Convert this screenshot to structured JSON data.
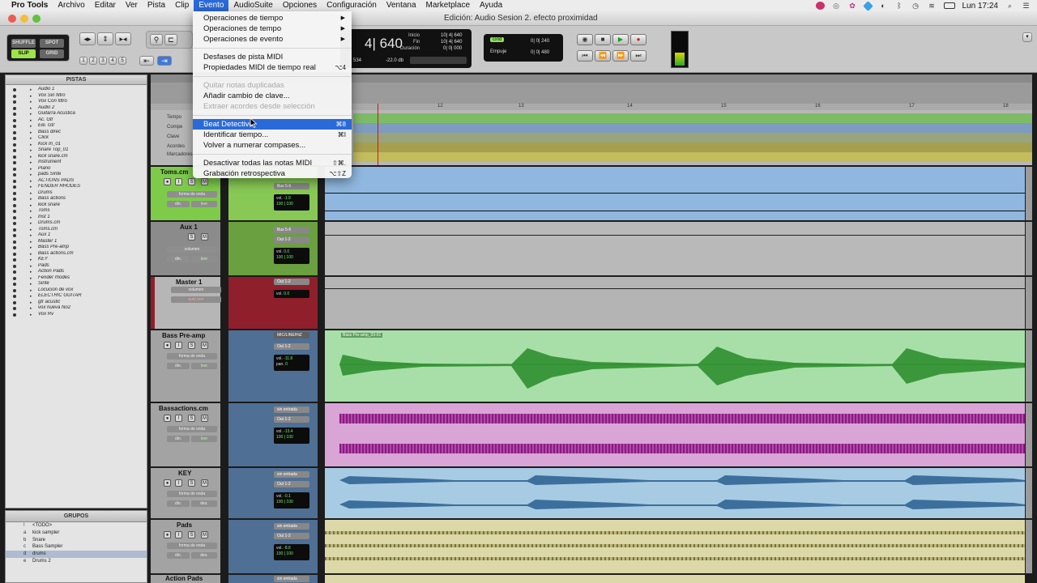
{
  "menubar": {
    "app": "Pro Tools",
    "items": [
      "Archivo",
      "Editar",
      "Ver",
      "Pista",
      "Clip",
      "Evento",
      "AudioSuite",
      "Opciones",
      "Configuración",
      "Ventana",
      "Marketplace",
      "Ayuda"
    ],
    "active": "Evento",
    "clock": "Lun 17:24"
  },
  "window": {
    "title": "Edición: Audio Sesion 2. efecto proximidad"
  },
  "toolbar": {
    "modes": {
      "shuffle": "SHUFFLE",
      "spot": "SPOT",
      "slip": "SLIP",
      "grid": "GRID"
    },
    "numbers": [
      "1",
      "2",
      "3",
      "4",
      "5"
    ],
    "counter_main": "4| 640",
    "counter_labels": {
      "start": "Inicio",
      "end": "Fin",
      "length": "Duración"
    },
    "counter_values": {
      "start": "10| 4| 640",
      "end": "10| 4| 640",
      "length": "0| 0| 000"
    },
    "counter_small_left": "534",
    "counter_small_right": "-22.0 db",
    "grid_label": "Grid",
    "nudge_label": "Empuje",
    "grid_value": "0| 0| 240",
    "nudge_value": "0| 0| 480"
  },
  "rulers": {
    "names": [
      "Tempo",
      "Compe",
      "Clave",
      "Acordes",
      "Marcadores"
    ],
    "bars": [
      "12",
      "13",
      "14",
      "15",
      "16",
      "17",
      "18"
    ]
  },
  "tracks_panel": {
    "header": "PISTAS",
    "tracks": [
      "Audio 1",
      "Vox Sin filtro",
      "Vox Con filtro",
      "Audio 2",
      "Guitarra Acustica",
      "Ac. Gtr",
      "Ele. Gtr",
      "Bass direc",
      "Click",
      "Kick In_01",
      "Snare Top_01",
      "kick snare.cm",
      "Instrument",
      "Piano",
      "pads Sinte",
      "ACTIONS PADS",
      "FENDER RHODES",
      "Drums",
      "Bass actions",
      "kick snare",
      "Toms",
      "Inst 1",
      "Drums.cm",
      "Toms.cm",
      "Aux 1",
      "Master 1",
      "Bass Pre-amp",
      "Bass actions.cm",
      "KEY",
      "Pads",
      "Action Pads",
      "Fender rhodes",
      "Sinte",
      "Locucion de vox",
      "ELECTRIC GUITAR",
      "gtr acustic",
      "vox nueva No2",
      "Vox Rv"
    ]
  },
  "groups_panel": {
    "header": "GRUPOS",
    "groups": [
      {
        "id": "!",
        "name": "<TODO>"
      },
      {
        "id": "a",
        "name": "kick sampler"
      },
      {
        "id": "b",
        "name": "Snare"
      },
      {
        "id": "c",
        "name": "Bass Sampler"
      },
      {
        "id": "d",
        "name": "drums"
      },
      {
        "id": "e",
        "name": "Drums 2"
      }
    ]
  },
  "edit_tracks": [
    {
      "name": "Toms.cm",
      "view": "forma de onda",
      "auto": "leer",
      "dyn": "din.",
      "io_out": "Bus 5-6",
      "vol": "-1.9",
      "pan": "100 | 100"
    },
    {
      "name": "Aux 1",
      "view": "volumen",
      "auto": "leer",
      "dyn": "din.",
      "io_in": "Bus 5-6",
      "io_out": "Out 1-2",
      "vol": "0.0",
      "pan": "100 | 100"
    },
    {
      "name": "Master 1",
      "view": "volumen",
      "auto": "auto leer",
      "io_out": "Out 1-2",
      "vol": "0.0"
    },
    {
      "name": "Bass Pre-amp",
      "view": "forma de onda",
      "auto": "leer",
      "dyn": "din.",
      "io_in": "MIC/LINE/HiZ",
      "io_out": "Out 1-2",
      "vol": "-11.8",
      "pan_label": "pan.",
      "pan": "0",
      "clip": "Bass Pre-amp_03-01"
    },
    {
      "name": "Bassactions.cm",
      "view": "forma de onda",
      "auto": "leer",
      "dyn": "din.",
      "io_in": "sin entrada",
      "io_out": "Out 1-2",
      "vol": "-13.4",
      "pan": "100 | 100"
    },
    {
      "name": "KEY",
      "view": "forma de onda",
      "auto": "des.",
      "dyn": "din.",
      "io_in": "sin entrada",
      "io_out": "Out 1-2",
      "vol": "-0.1",
      "pan": "100 | 100"
    },
    {
      "name": "Pads",
      "view": "forma de onda",
      "auto": "des.",
      "dyn": "din.",
      "io_in": "sin entrada",
      "io_out": "Out 1-2",
      "vol": "-8.6",
      "pan": "100 | 100"
    },
    {
      "name": "Action Pads",
      "io_in": "sin entrada"
    }
  ],
  "evento_menu": {
    "items": [
      {
        "label": "Operaciones de tiempo",
        "submenu": true
      },
      {
        "label": "Operaciones de tempo",
        "submenu": true
      },
      {
        "label": "Operaciones de evento",
        "submenu": true
      },
      {
        "sep": true
      },
      {
        "label": "Desfases de pista MIDI"
      },
      {
        "label": "Propiedades MIDI de tiempo real",
        "shortcut": "⌥4"
      },
      {
        "sep": true
      },
      {
        "label": "Quitar notas duplicadas",
        "disabled": true
      },
      {
        "label": "Añadir cambio de clave..."
      },
      {
        "label": "Extraer acordes desde selección",
        "disabled": true
      },
      {
        "sep": true
      },
      {
        "label": "Beat Detective",
        "shortcut": "⌘8",
        "highlighted": true
      },
      {
        "label": "Identificar tiempo...",
        "shortcut": "⌘I"
      },
      {
        "label": "Volver a numerar compases..."
      },
      {
        "sep": true
      },
      {
        "label": "Desactivar todas las notas MIDI",
        "shortcut": "⇧⌘."
      },
      {
        "label": "Grabación retrospectiva",
        "shortcut": "⌥⇧Z"
      }
    ]
  },
  "colors": {
    "highlight": "#2a6ad8",
    "track_green": "#7ecb4a",
    "track_red": "#8f1f2a",
    "track_blue": "#5a7fa8",
    "clip_green": "#a8dfa8",
    "clip_purple": "#d8a5d6",
    "clip_blue": "#a8cbe4",
    "clip_yellow": "#ddd8a8"
  }
}
